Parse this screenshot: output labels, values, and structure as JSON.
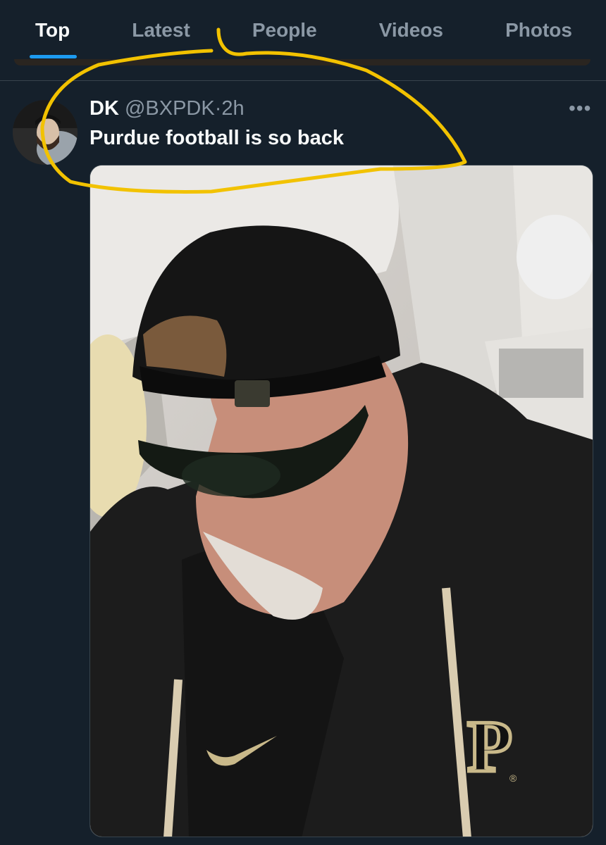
{
  "tabs": [
    {
      "label": "Top",
      "active": true
    },
    {
      "label": "Latest",
      "active": false
    },
    {
      "label": "People",
      "active": false
    },
    {
      "label": "Videos",
      "active": false
    },
    {
      "label": "Photos",
      "active": false
    }
  ],
  "tweet": {
    "display_name": "DK",
    "handle": "@BXPDK",
    "separator": "·",
    "time": "2h",
    "text": "Purdue football is so back",
    "more_icon": "more-horizontal-icon"
  },
  "media": {
    "logo_letter": "P",
    "logo_mark": "®"
  },
  "colors": {
    "background": "#15202b",
    "accent": "#1d9bf0",
    "secondary_text": "#8b98a5",
    "annotation": "#f2c200"
  }
}
